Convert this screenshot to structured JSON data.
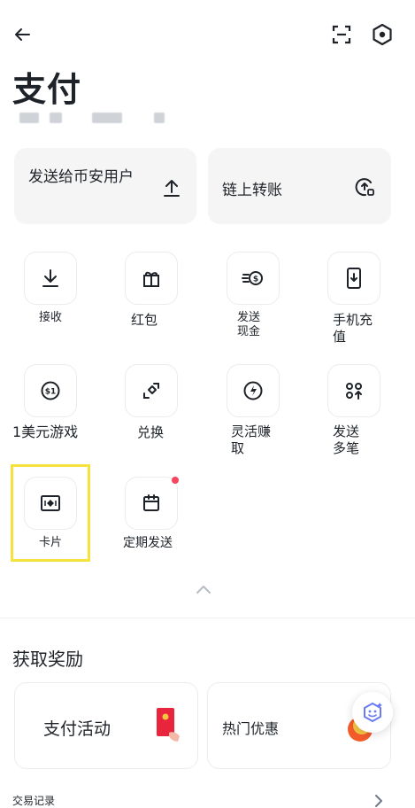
{
  "header": {
    "back_icon": "arrow-left-icon",
    "scan_icon": "scan-icon",
    "settings_icon": "hex-settings-icon",
    "title": "支付"
  },
  "quick_actions": {
    "send_user_label": "发送给币安用户",
    "onchain_label": "链上转账"
  },
  "grid": [
    {
      "label": "接收",
      "icon": "download-icon"
    },
    {
      "label": "红包",
      "icon": "gift-icon"
    },
    {
      "label": "发送\n现金",
      "icon": "cash-send-icon"
    },
    {
      "label": "手机充\n值",
      "icon": "phone-topup-icon"
    },
    {
      "label": "1美元游戏",
      "icon": "dollar-coin-icon"
    },
    {
      "label": "兑换",
      "icon": "redeem-icon"
    },
    {
      "label": "灵活赚\n取",
      "icon": "flexible-earn-icon"
    },
    {
      "label": "发送\n多笔",
      "icon": "multi-send-icon"
    },
    {
      "label": "卡片",
      "icon": "card-icon"
    },
    {
      "label": "定期发送",
      "icon": "calendar-icon"
    }
  ],
  "collapse_icon": "chevron-up-icon",
  "rewards": {
    "title": "获取奖励",
    "promo1": "支付活动",
    "promo2": "热门优惠"
  },
  "history_label": "交易记录",
  "colors": {
    "accent_yellow": "#f5e23a",
    "red_dot": "#f6465d",
    "text": "#1e2329",
    "card_bg": "#f5f5f5"
  }
}
